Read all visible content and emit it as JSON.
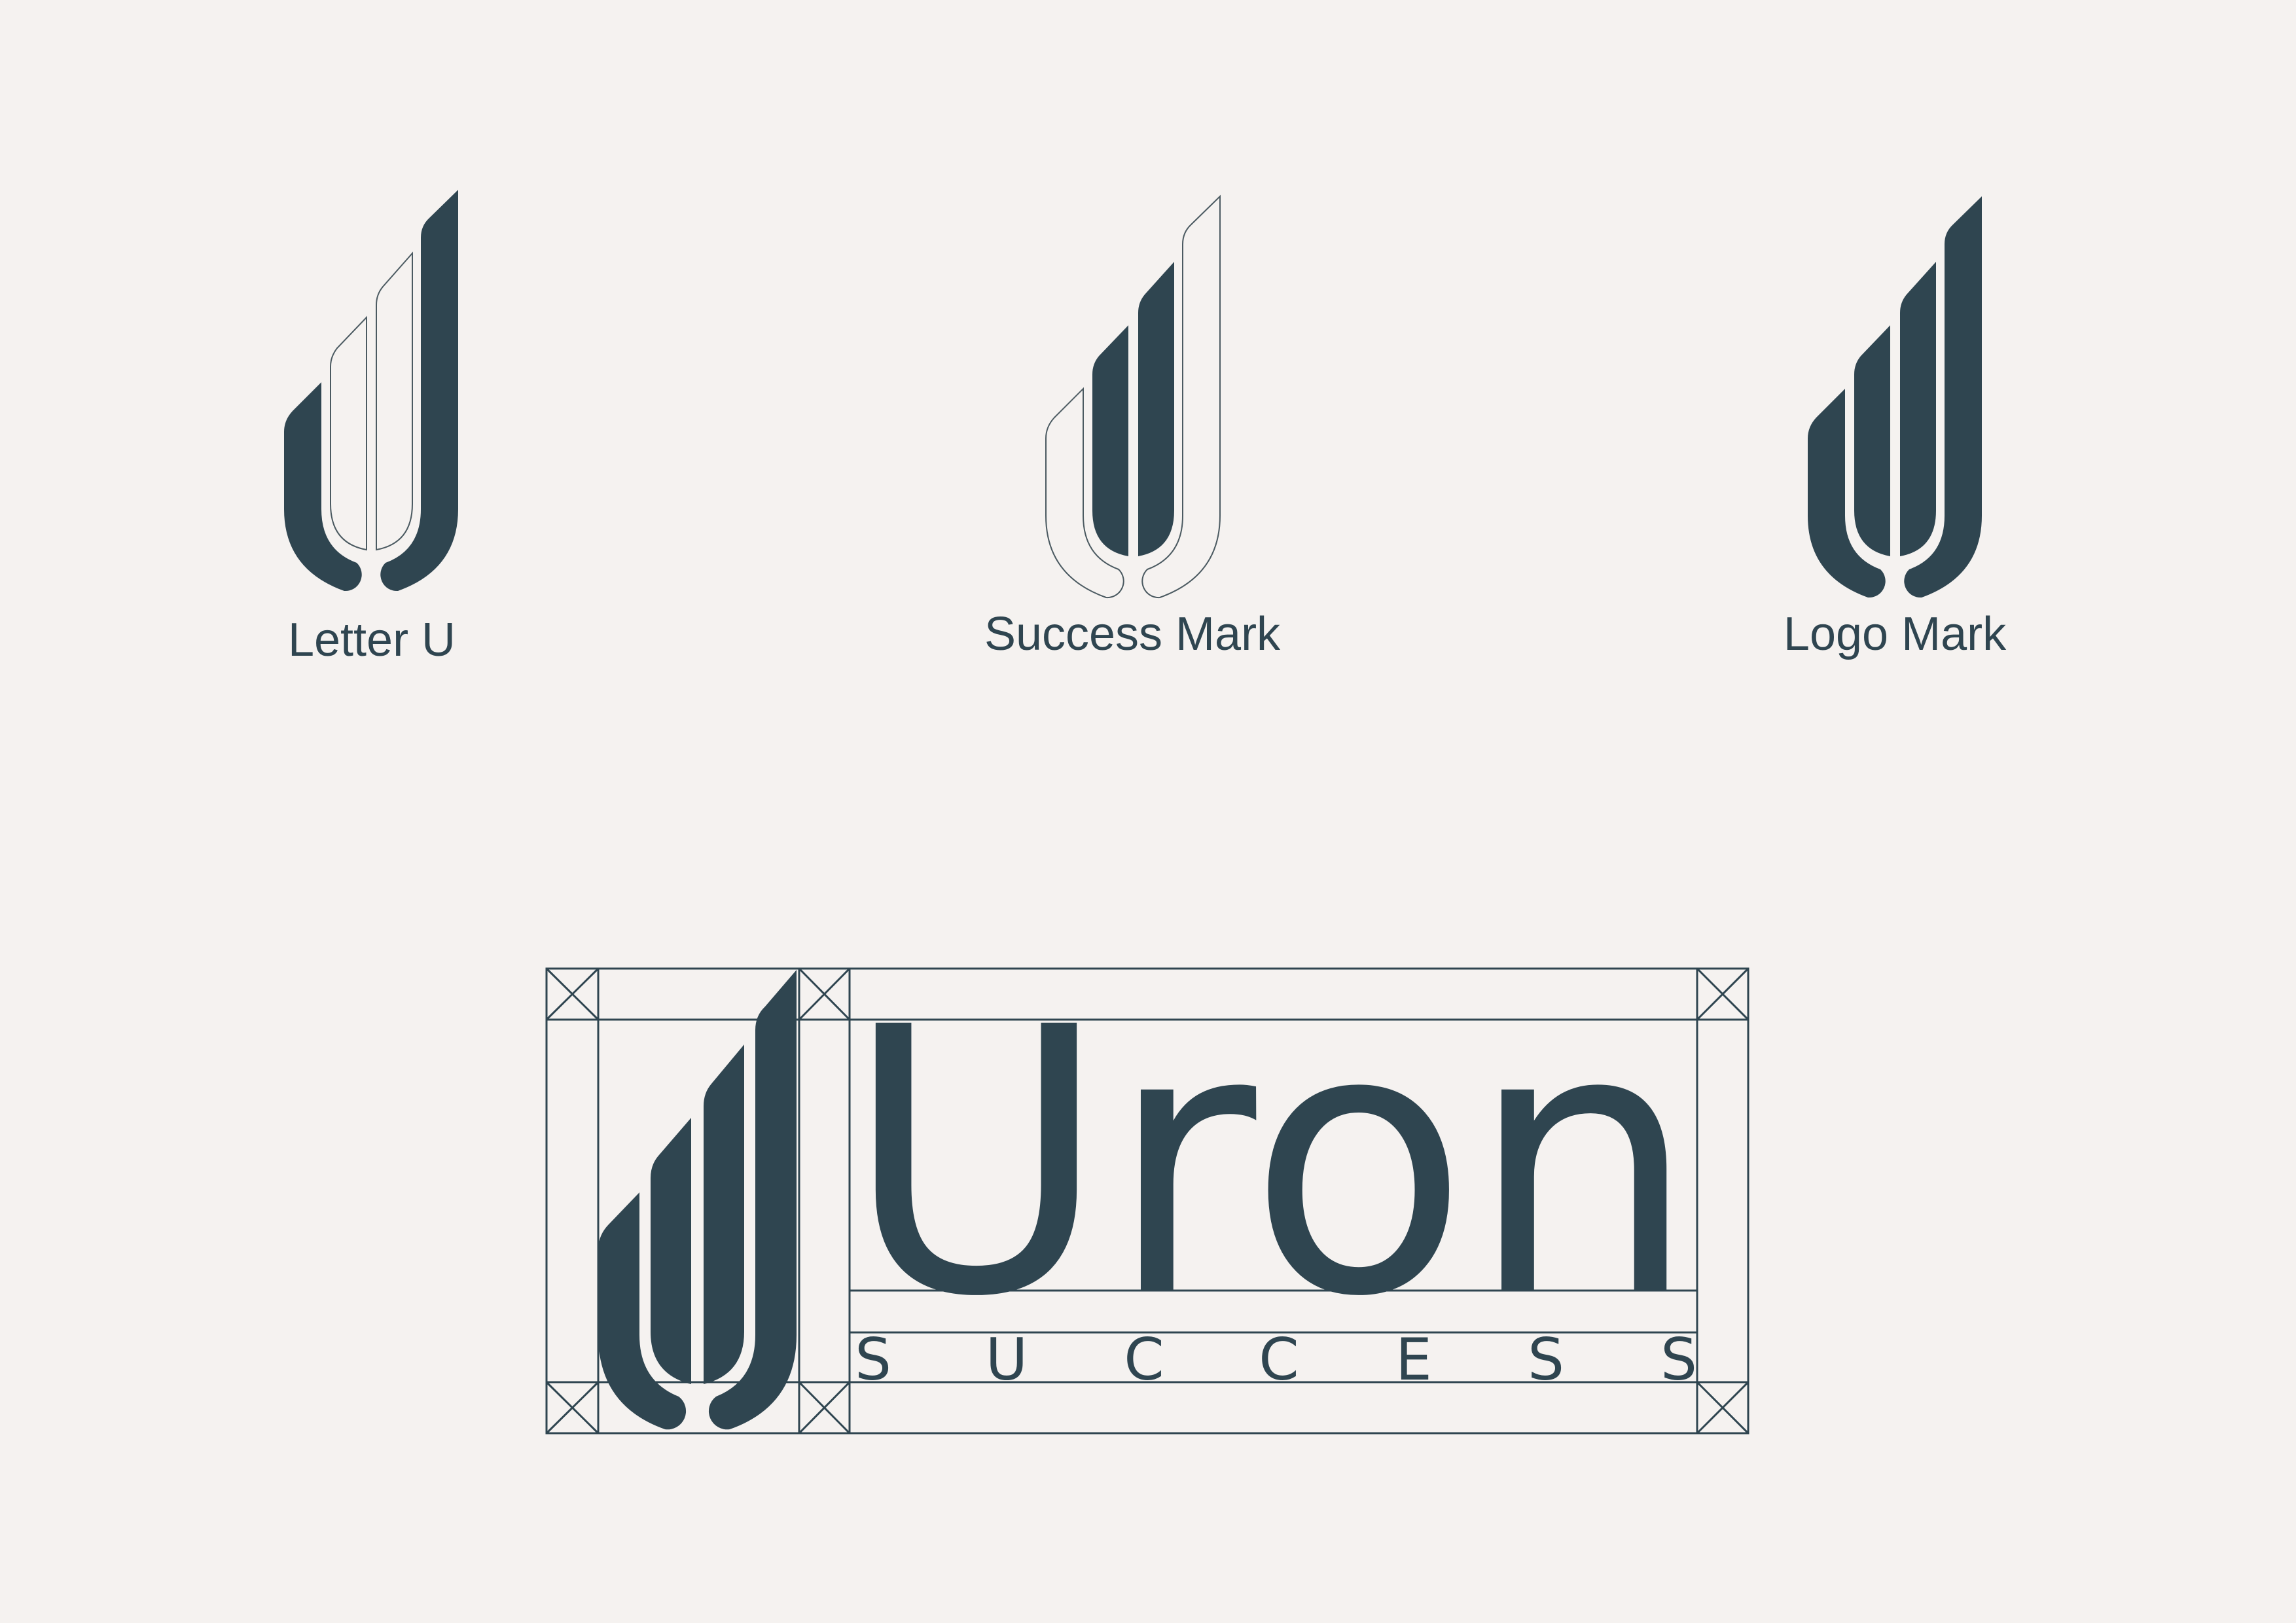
{
  "captions": {
    "letter_u": "Letter U",
    "success_mark": "Success Mark",
    "logo_mark": "Logo Mark"
  },
  "wordmark": {
    "name": "Uron",
    "tagline_letters": [
      "S",
      "U",
      "C",
      "C",
      "E",
      "S",
      "S"
    ]
  },
  "colors": {
    "background": "#f5f2f0",
    "ink": "#2f4550",
    "outline": "#4b5a61"
  },
  "icons": [
    "letter-u-icon",
    "success-mark-icon",
    "logo-mark-icon",
    "construction-grid-icon"
  ]
}
